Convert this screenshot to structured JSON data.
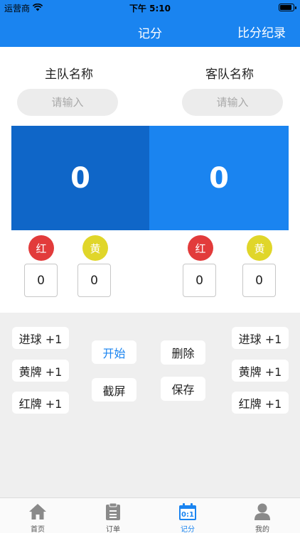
{
  "status": {
    "carrier": "运营商",
    "time": "下午 5:10"
  },
  "nav": {
    "title": "记分",
    "right_action": "比分纪录"
  },
  "teams": {
    "home": {
      "label": "主队名称",
      "placeholder": "请输入",
      "score": "0"
    },
    "away": {
      "label": "客队名称",
      "placeholder": "请输入",
      "score": "0"
    }
  },
  "cards": {
    "red_label": "红",
    "yellow_label": "黄",
    "home_red": "0",
    "home_yellow": "0",
    "away_red": "0",
    "away_yellow": "0"
  },
  "controls": {
    "goal": "进球 +1",
    "yellow_card": "黄牌 +1",
    "red_card": "红牌 +1",
    "start": "开始",
    "screenshot": "截屏",
    "delete": "删除",
    "save": "保存"
  },
  "tabs": [
    {
      "label": "首页",
      "icon": "home-icon"
    },
    {
      "label": "订单",
      "icon": "clipboard-icon"
    },
    {
      "label": "记分",
      "icon": "scoreboard-icon",
      "active": true,
      "icon_text": "0:1"
    },
    {
      "label": "我的",
      "icon": "person-icon"
    }
  ],
  "colors": {
    "primary": "#1a84f0",
    "home_box": "#0f66c8",
    "red": "#e23b3b",
    "yellow": "#e0d62a"
  }
}
